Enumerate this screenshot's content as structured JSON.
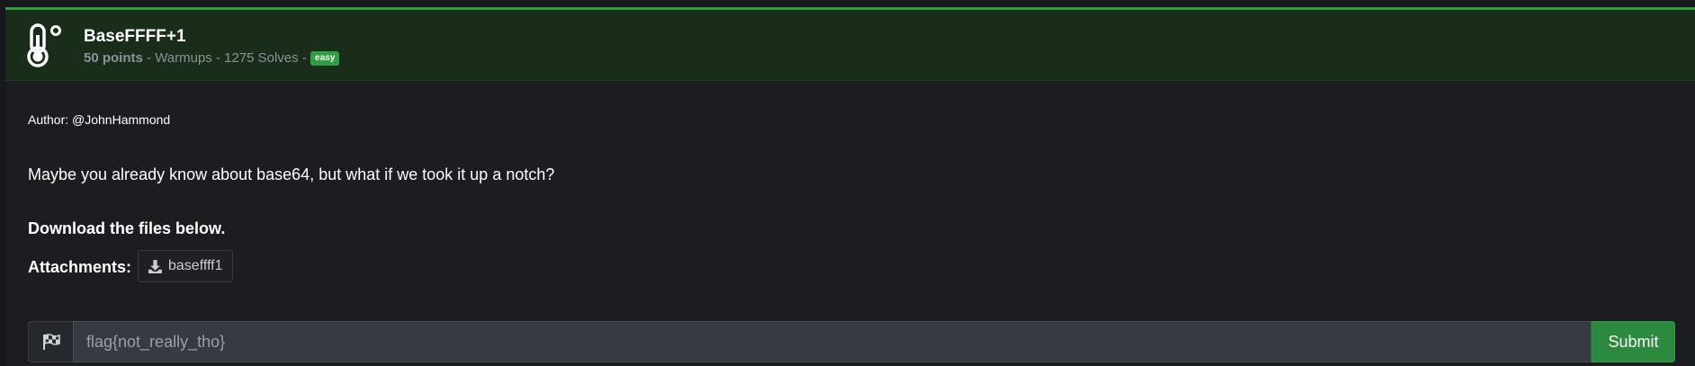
{
  "challenge": {
    "title": "BaseFFFF+1",
    "points": "50 points",
    "meta_rest": " - Warmups - 1275 Solves - ",
    "difficulty": "easy",
    "icon": "thermometer-icon"
  },
  "content": {
    "author": "Author: @JohnHammond",
    "description": "Maybe you already know about base64, but what if we took it up a notch?",
    "download": "Download the files below.",
    "attachments_label": "Attachments:",
    "attachment_name": "baseffff1",
    "attachment_icon": "download-icon"
  },
  "flag_form": {
    "icon": "flag-icon",
    "placeholder": "flag{not_really_tho}",
    "submit_label": "Submit"
  },
  "colors": {
    "accent": "#2ea043",
    "header_bg": "#192d1a",
    "page_bg": "#1b1d20",
    "submit_bg": "#2b8a3e"
  }
}
